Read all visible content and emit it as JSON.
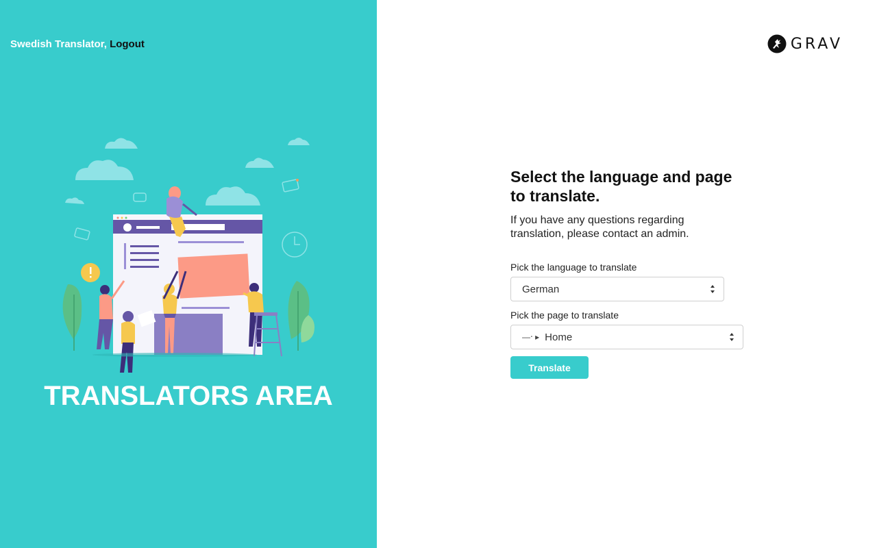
{
  "header": {
    "user_name": "Swedish Translator",
    "separator": ", ",
    "logout_label": "Logout"
  },
  "hero": {
    "title": "TRANSLATORS AREA"
  },
  "logo": {
    "text": "GRAV"
  },
  "form": {
    "heading": "Select the language and page to translate.",
    "subtext": "If you have any questions regarding translation, please contact an admin.",
    "language_label": "Pick the language to translate",
    "language_value": "German",
    "page_label": "Pick the page to translate",
    "page_prefix": "—‧ ▸",
    "page_value": "Home",
    "submit_label": "Translate"
  },
  "colors": {
    "accent": "#38cccc",
    "text_dark": "#111111"
  }
}
